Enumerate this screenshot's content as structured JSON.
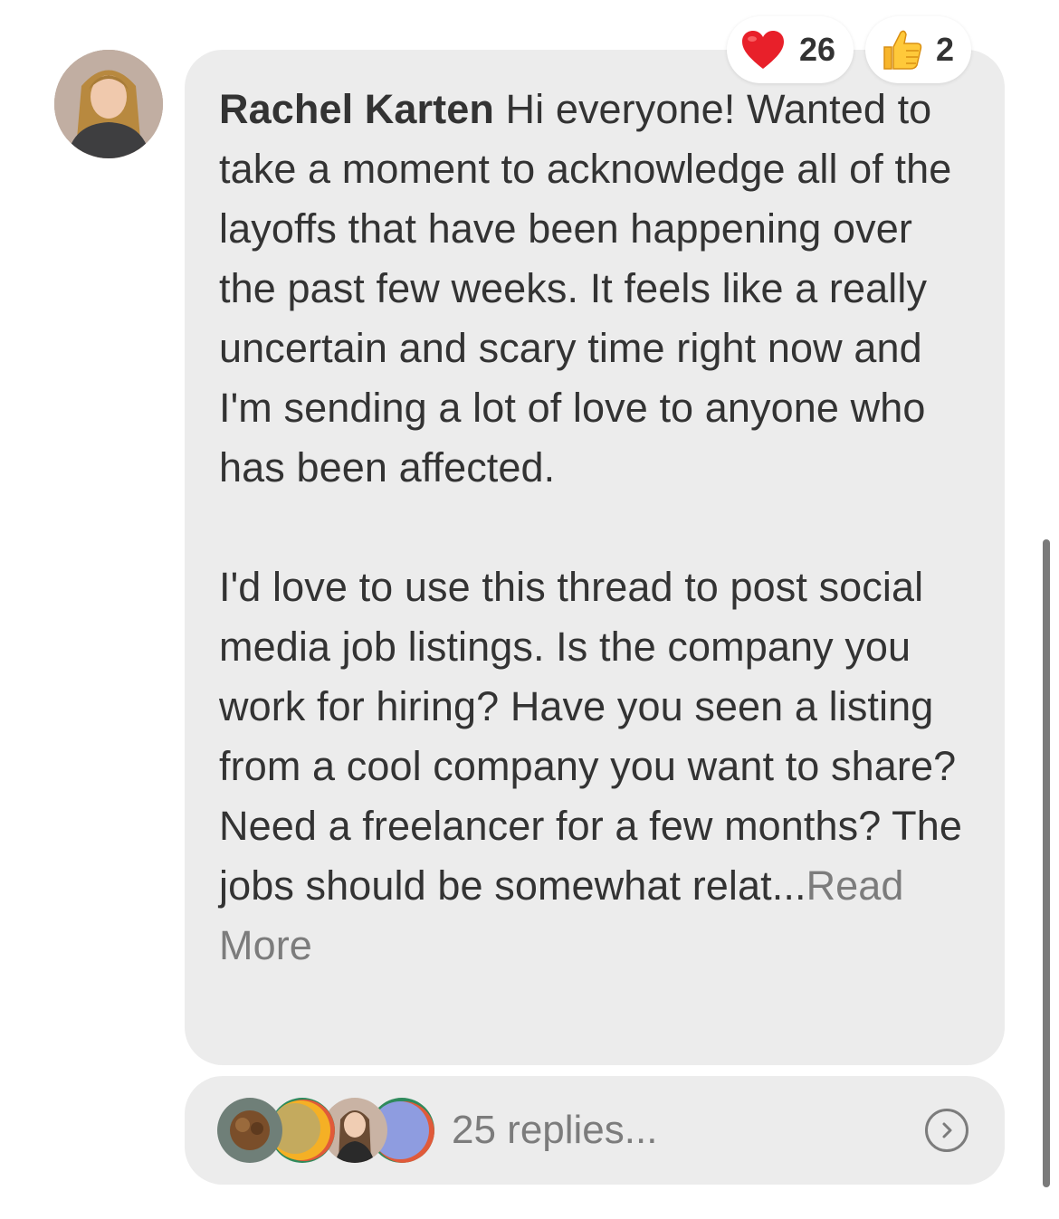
{
  "author": {
    "name": "Rachel Karten"
  },
  "message": {
    "paragraph1": "Hi everyone! Wanted to take a moment to acknowledge all of the layoffs that have been happening over the past few weeks. It feels like a really uncertain and scary time right now and I'm sending a lot of love to anyone who has been affected.",
    "paragraph2": "I'd love to use this thread to post social media job listings. Is the company you work for hiring? Have you seen a listing from a cool company you want to share? Need a freelancer for a few months? The jobs should be somewhat relat...",
    "read_more_label": "Read More"
  },
  "reactions": [
    {
      "icon": "red-heart-icon",
      "count": "26"
    },
    {
      "icon": "thumbs-up-icon",
      "count": "2"
    }
  ],
  "replies": {
    "label": "25 replies...",
    "avatar_colors": [
      "#8a6a4a",
      "#f5b025",
      "#c9a890",
      "#8e9ce0"
    ]
  },
  "colors": {
    "bubble": "#ececec",
    "text": "#333333",
    "muted": "#7c7c7c"
  }
}
